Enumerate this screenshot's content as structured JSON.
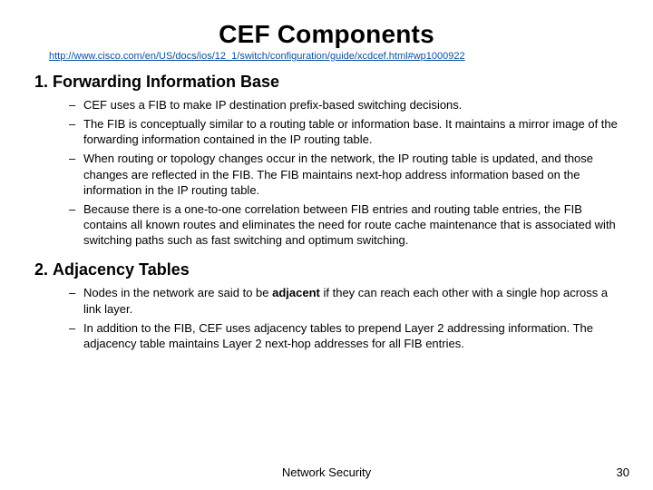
{
  "title": "CEF Components",
  "url": "http://www.cisco.com/en/US/docs/ios/12_1/switch/configuration/guide/xcdcef.html#wp1000922",
  "sections": [
    {
      "heading": "Forwarding Information Base",
      "bullets": [
        "CEF uses a FIB to make IP destination prefix-based switching decisions.",
        "The FIB is conceptually similar to a routing table or information base. It maintains a mirror image of the forwarding information contained in the IP routing table.",
        "When routing or topology changes occur in the network, the IP routing table is updated, and those changes are reflected in the FIB. The FIB maintains next-hop address information based on the information in the IP routing table.",
        "Because there is a one-to-one correlation between FIB entries and routing table entries, the FIB contains all known routes and eliminates the need for route cache maintenance that is associated with switching paths such as fast switching and optimum switching."
      ]
    },
    {
      "heading": "Adjacency Tables",
      "bullets": [
        "Nodes in the network are said to be adjacent if they can reach each other with a single hop across a link layer.",
        "In addition to the FIB, CEF uses adjacency tables to prepend Layer 2 addressing information. The adjacency table maintains Layer 2 next-hop addresses for all FIB entries."
      ]
    }
  ],
  "footer_center": "Network Security",
  "footer_right": "30"
}
